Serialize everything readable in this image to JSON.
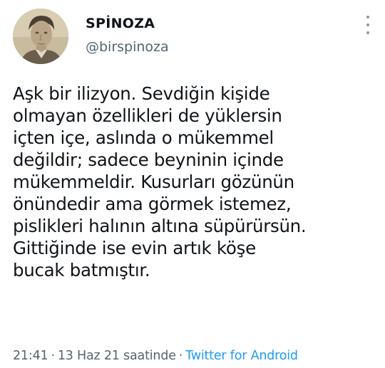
{
  "author": {
    "display_name": "SPİNOZA",
    "handle": "@birspinoza",
    "avatar_icon": "profile-photo"
  },
  "tweet": {
    "lines": [
      "Aşk bir ilizyon. Sevdiğin kişide",
      "olmayan özellikleri de yüklersin",
      "içten içe, aslında o mükemmel",
      "değildir; sadece beyninin içinde",
      "mükemmeldir. Kusurları gözünün",
      "önündedir ama görmek istemez,",
      "pislikleri halının altına süpürürsün.",
      "Gittiğinde ise evin artık köşe",
      "bucak batmıştır."
    ]
  },
  "meta": {
    "time": "21:41",
    "date": "13 Haz 21 saatinde",
    "separator": "·",
    "source": "Twitter for Android"
  },
  "colors": {
    "text": "#0f1419",
    "secondary": "#536471",
    "link": "#1d9bf0"
  }
}
